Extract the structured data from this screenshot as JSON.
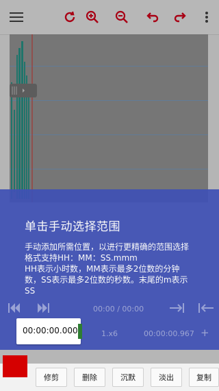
{
  "toolbar": {
    "icons": [
      "menu-icon",
      "refresh-icon",
      "zoom-in-icon",
      "zoom-out-icon",
      "undo-icon",
      "redo-icon",
      "more-icon"
    ]
  },
  "tutorial": {
    "title": "单击手动选择范围",
    "line1": "手动添加所需位置，以进行更精确的范围选择",
    "line2": "格式支持HH：MM：SS.mmm",
    "line3": "HH表示小时数，MM表示最多2位数的分钟",
    "line4": "数，SS表示最多2位数的秒数。末尾的m表示",
    "line5": "SS"
  },
  "player": {
    "position": "00:00 / 00:00",
    "speed": "1.x6",
    "end_time": "00:00:00.967"
  },
  "time_input": {
    "value": "00:00:00.000"
  },
  "actions": {
    "trim": "修剪",
    "delete": "删除",
    "silence": "沉默",
    "fade_out": "淡出",
    "copy": "复制"
  },
  "colors": {
    "accent": "#e0001b",
    "overlay": "#3f51b5",
    "wave": "#2a9d8f"
  }
}
